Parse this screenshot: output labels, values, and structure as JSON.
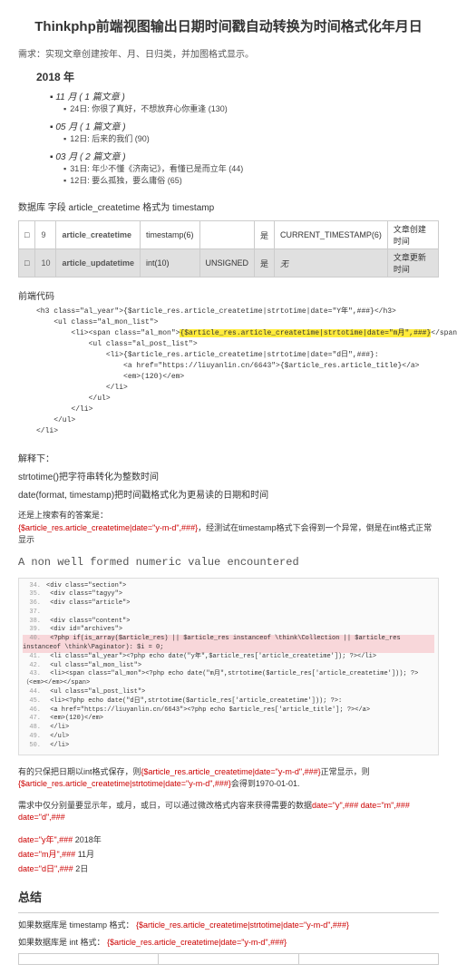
{
  "title": "Thinkphp前端视图输出日期时间戳自动转换为时间格式化年月日",
  "requirement": "需求：实现文章创建按年、月、日归类，并加图格式显示。",
  "year_header": "2018 年",
  "months": [
    {
      "line": "11 月 ( 1 篇文章 )",
      "posts": [
        "24日: 你很了真好，不想放弃心你重逢 (130)"
      ]
    },
    {
      "line": "05 月 ( 1 篇文章 )",
      "posts": [
        "12日: 后来的我们 (90)"
      ]
    },
    {
      "line": "03 月 ( 2 篇文章 )",
      "posts": [
        "31日: 年少不懂《济南记》，看懂已是而立年 (44)",
        "12日: 要么孤独，要么庸俗 (65)"
      ]
    }
  ],
  "db_note": "数据库 字段 article_createtime 格式为 timestamp",
  "dbfields": {
    "r1": {
      "idx": "9",
      "name": "article_createtime",
      "type": "timestamp(6)",
      "attr": "",
      "def": "CURRENT_TIMESTAMP(6)",
      "comment": "文章创建时间"
    },
    "r2": {
      "idx": "10",
      "name": "article_updatetime",
      "type": "int(10)",
      "attr": "UNSIGNED",
      "def": "无",
      "comment": "文章更新时间"
    }
  },
  "front_code_label": "前端代码",
  "code_main": "<h3 class=\"al_year\">{$article_res.article_createtime|strtotime|date=\"Y年\",###}</h3>\n    <ul class=\"al_mon_list\">\n        <li><span class=\"al_mon\">",
  "code_hl": "{$article_res.article_createtime|strtotime|date=\"m月\",###}",
  "code_main2": "</span>（<em></em></span>\n            <ul class=\"al_post_list\">\n                <li>{$article_res.article_createtime|strtotime|date=\"d日\",###}:\n                    <a href=\"https://liuyanlin.cn/6643\">{$article_res.article_title}</a>\n                    <em>(120)</em>\n                </li>\n            </ul>\n        </li>\n    </ul>\n</li>",
  "explain_header": "解释下：",
  "explain_lines": [
    "strtotime()把字符串转化为整数时间",
    "date(format, timestamp)把时间戳格式化为更易读的日期和时间"
  ],
  "result_line1": "还是上搜索有的答案是：",
  "result_red": "{$article_res.article_createtime|date=\"y-m-d\",###}",
  "result_line2": "，经测试在timestamp格式下会得到一个异常，倒是在int格式正常显示",
  "error_title": "A non well formed numeric value encountered",
  "err_lines": [
    {
      "n": "34.",
      "t": "<div class=\"section\">"
    },
    {
      "n": "35.",
      "t": "    <div class=\"tagyy\">"
    },
    {
      "n": "36.",
      "t": "        <div class=\"article\">"
    },
    {
      "n": "37.",
      "t": ""
    },
    {
      "n": "38.",
      "t": "            <div class=\"content\">"
    },
    {
      "n": "39.",
      "t": "                <div id=\"archives\">"
    },
    {
      "n": "40.",
      "t": "                    <?php if(is_array($article_res) || $article_res instanceof \\think\\Collection || $article_res instanceof \\think\\Paginator): $i = 0;",
      "hl": true
    },
    {
      "n": "41.",
      "t": "                        <li class=\"al_year\"><?php echo date(\"y年\",$article_res['article_createtime']); ?></li>"
    },
    {
      "n": "42.",
      "t": "                            <ul class=\"al_mon_list\">"
    },
    {
      "n": "43.",
      "t": "                                <li><span class=\"al_mon\"><?php echo date(\"m月\",strtotime($article_res['article_createtime'])); ?>（<em></em></span>"
    },
    {
      "n": "44.",
      "t": "                                    <ul class=\"al_post_list\">"
    },
    {
      "n": "45.",
      "t": "                                        <li><?php echo date(\"d日\",strtotime($article_res['article_createtime'])); ?>:"
    },
    {
      "n": "46.",
      "t": "                                            <a href=\"https://liuyanlin.cn/6643\"><?php echo $article_res['article_title']; ?></a>"
    },
    {
      "n": "47.",
      "t": "                                            <em>(120)</em>"
    },
    {
      "n": "48.",
      "t": "                                        </li>"
    },
    {
      "n": "49.",
      "t": "                                    </ul>"
    },
    {
      "n": "50.",
      "t": "                                </li>"
    }
  ],
  "note1a": "有的只保把日期以int格式保存，则",
  "note1b": "{$article_res.article_createtime|date=\"y-m-d\",###}",
  "note1c": "正常显示，则",
  "note1d": "{$article_res.article_createtime|strtotime|date=\"y-m-d\",###}",
  "note1e": "会得到1970-01-01.",
  "note2a": "需求中仅分别量要显示年，或月，或日，可以通过微改格式内容来获得需要的数据",
  "note2b": "date=\"y\",###   date=\"m\",###  date=\"d\",###",
  "kv": [
    {
      "k": "date=\"y年\",###",
      "v": "2018年"
    },
    {
      "k": "date=\"m月\",###",
      "v": "11月"
    },
    {
      "k": "date=\"d日\",###",
      "v": "2日"
    }
  ],
  "summary": "总结",
  "bottom1a": "如果数据库是 timestamp 格式：",
  "bottom1b": "{$article_res.article_createtime|strtotime|date=\"y-m-d\",###}",
  "bottom2a": "如果数据库是 int 格式：",
  "bottom2b": "{$article_res.article_createtime|date=\"y-m-d\",###}"
}
